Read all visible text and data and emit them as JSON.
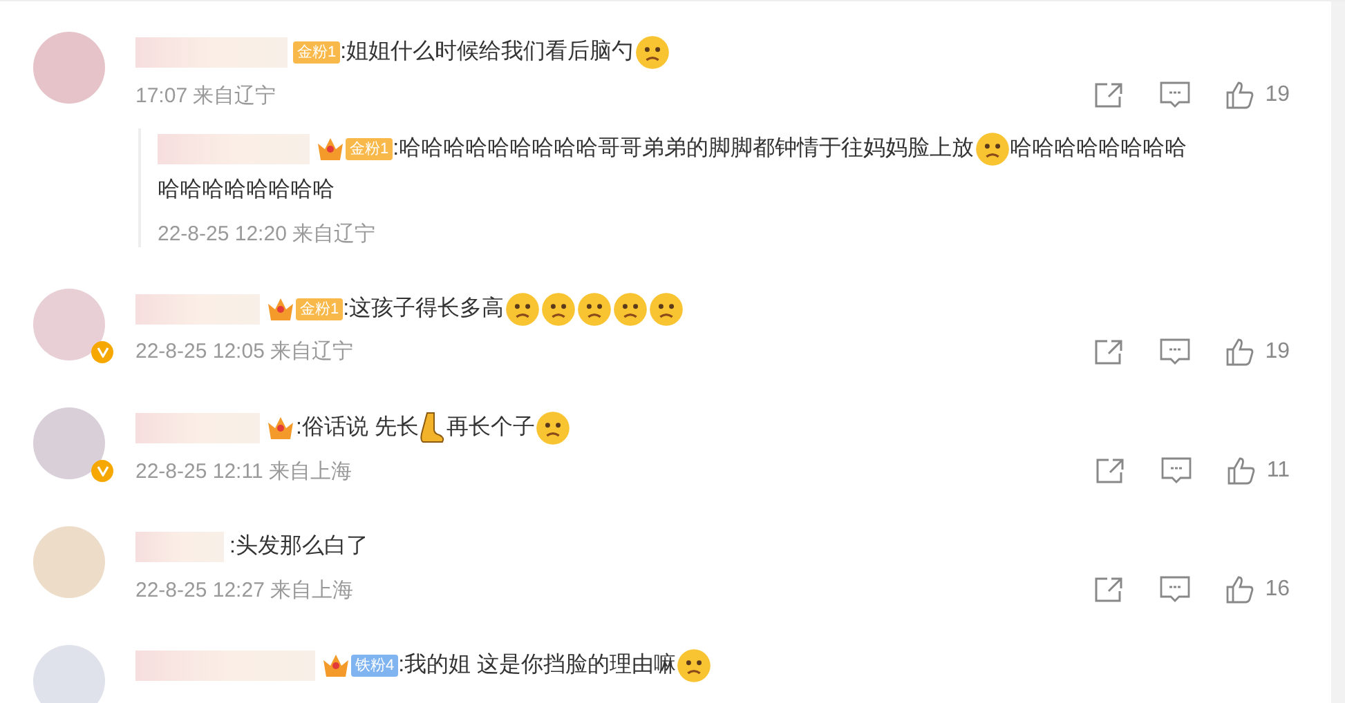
{
  "comments": [
    {
      "badge": {
        "crown": false,
        "label": "金粉1",
        "color": "#f8b94a"
      },
      "verified": false,
      "content": [
        {
          "kind": "text",
          "text": ":姐姐什么时候给我们看后脑勺"
        },
        {
          "kind": "face"
        }
      ],
      "meta": "17:07 来自辽宁",
      "likes": "19",
      "replies": [
        {
          "badge": {
            "crown": true,
            "label": "金粉1",
            "color": "#f8b94a"
          },
          "content": [
            {
              "kind": "text",
              "text": ":哈哈哈哈哈哈哈哈哈哥哥弟弟的脚脚都钟情于往妈妈脸上放"
            },
            {
              "kind": "face"
            },
            {
              "kind": "text",
              "text": "哈哈哈哈哈哈哈哈"
            },
            {
              "kind": "text",
              "text": "哈哈哈哈哈哈哈哈"
            }
          ],
          "meta": "22-8-25 12:20 来自辽宁"
        }
      ]
    },
    {
      "badge": {
        "crown": true,
        "label": "金粉1",
        "color": "#f8b94a"
      },
      "verified": true,
      "content": [
        {
          "kind": "text",
          "text": ":这孩子得长多高"
        },
        {
          "kind": "face"
        },
        {
          "kind": "face"
        },
        {
          "kind": "face"
        },
        {
          "kind": "face"
        },
        {
          "kind": "face"
        }
      ],
      "meta": "22-8-25 12:05 来自辽宁",
      "likes": "19"
    },
    {
      "badge": {
        "crown": true
      },
      "verified": true,
      "content": [
        {
          "kind": "text",
          "text": ":俗话说 先长"
        },
        {
          "kind": "foot"
        },
        {
          "kind": "text",
          "text": "再长个子"
        },
        {
          "kind": "face"
        }
      ],
      "meta": "22-8-25 12:11 来自上海",
      "likes": "11"
    },
    {
      "verified": false,
      "content": [
        {
          "kind": "text",
          "text": ":头发那么白了"
        }
      ],
      "meta": "22-8-25 12:27 来自上海",
      "likes": "16"
    },
    {
      "badge": {
        "crown": true,
        "label": "铁粉4",
        "color": "#7fb4f0"
      },
      "verified": false,
      "content": [
        {
          "kind": "text",
          "text": ":我的姐 这是你挡脸的理由嘛"
        },
        {
          "kind": "face"
        }
      ]
    }
  ]
}
